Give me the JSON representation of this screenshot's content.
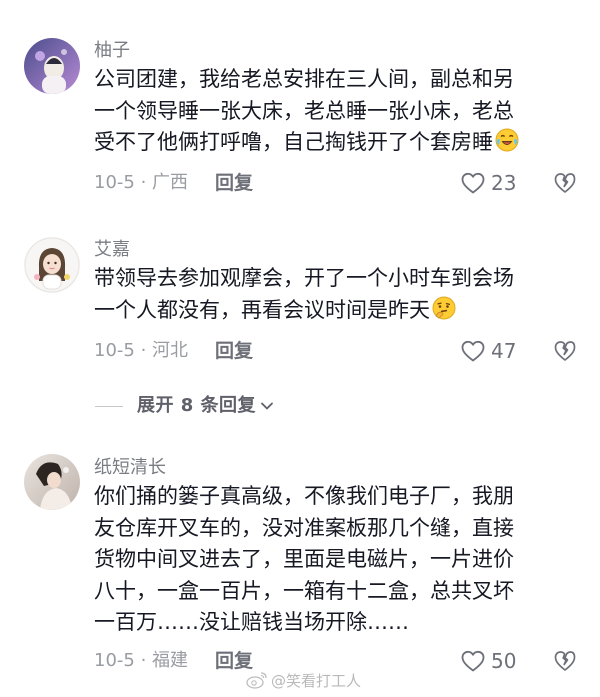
{
  "comments": [
    {
      "username": "柚子",
      "lines": [
        "公司团建，我给老总安排在三人间，副总和另",
        "一个领导睡一张大床，老总睡一张小床，老总",
        "受不了他俩打呼噜，自己掏钱开了个套房睡"
      ],
      "emoji": "laugh-cry-emoji",
      "date_location": "10-5 · 广西",
      "reply_label": "回复",
      "likes": "23"
    },
    {
      "username": "艾嘉",
      "lines": [
        "带领导去参加观摩会，开了一个小时车到会场",
        "一个人都没有，再看会议时间是昨天"
      ],
      "emoji": "thinking-emoji",
      "date_location": "10-5 · 河北",
      "reply_label": "回复",
      "likes": "47"
    },
    {
      "username": "纸短清长",
      "lines": [
        "你们捅的篓子真高级，不像我们电子厂，我朋",
        "友仓库开叉车的，没对准案板那几个缝，直接",
        "货物中间叉进去了，里面是电磁片，一片进价",
        "八十，一盒一百片，一箱有十二盒，总共叉坏",
        "一百万……没让赔钱当场开除……"
      ],
      "date_location": "10-5 · 福建",
      "reply_label": "回复",
      "likes": "50"
    }
  ],
  "expand_replies": "展开 8 条回复",
  "watermark": "@笑看打工人"
}
